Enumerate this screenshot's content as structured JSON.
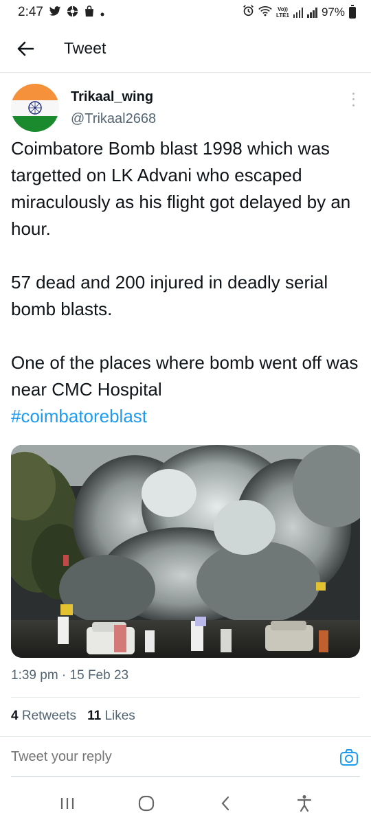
{
  "status_bar": {
    "time": "2:47",
    "battery": "97%",
    "lte_top": "Vo))",
    "lte_bottom": "LTE1"
  },
  "header": {
    "title": "Tweet"
  },
  "tweet": {
    "author_name": "Trikaal_wing",
    "author_handle": "@Trikaal2668",
    "paragraphs": [
      "Coimbatore Bomb blast 1998 which was targetted on LK Advani who escaped miraculously as his flight got delayed by an hour.",
      "57 dead and 200 injured in deadly serial bomb blasts.",
      "One of the places where bomb went off was near CMC Hospital"
    ],
    "hashtag": "#coimbatoreblast",
    "timestamp": "1:39 pm · 15 Feb 23",
    "retweets_count": "4",
    "retweets_label": "Retweets",
    "likes_count": "11",
    "likes_label": "Likes"
  },
  "reply": {
    "placeholder": "Tweet your reply"
  },
  "colors": {
    "accent": "#1d9bf0",
    "text": "#0f1419",
    "secondary": "#536471",
    "saffron": "#f4913a",
    "green": "#1b8a2e"
  },
  "icons": {
    "back": "arrow-left-icon",
    "more": "more-vertical-icon",
    "camera": "camera-icon",
    "nav_recents": "recents-icon",
    "nav_home": "home-icon",
    "nav_back": "chevron-left-icon",
    "nav_accessibility": "accessibility-icon"
  }
}
